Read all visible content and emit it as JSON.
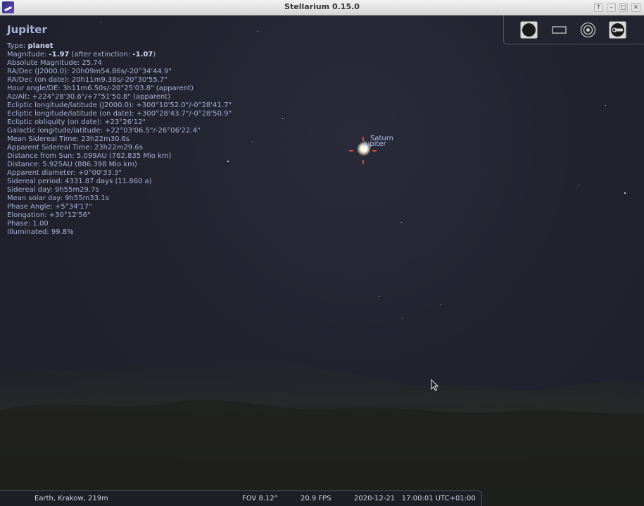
{
  "window": {
    "title": "Stellarium 0.15.0",
    "buttons": [
      "↑",
      "–",
      "□",
      "✕"
    ]
  },
  "object": {
    "name": "Jupiter",
    "info": [
      [
        "Type: ",
        "planet",
        ""
      ],
      [
        "Magnitude: ",
        "-1.97",
        " (after extinction: ",
        "-1.07",
        ")"
      ],
      [
        "Absolute Magnitude: 25.74"
      ],
      [
        "RA/Dec (J2000.0): 20h09m54.86s/-20°34'44.9\""
      ],
      [
        "RA/Dec (on date): 20h11m9.38s/-20°30'55.7\""
      ],
      [
        "Hour angle/DE: 3h11m6.50s/-20°25'03.8\" (apparent)"
      ],
      [
        "Az/Alt: +224°28'30.6\"/+7°51'50.8\" (apparent)"
      ],
      [
        "Ecliptic longitude/latitude (J2000.0): +300°10'52.0\"/-0°28'41.7\""
      ],
      [
        "Ecliptic longitude/latitude (on date): +300°28'43.7\"/-0°28'50.9\""
      ],
      [
        "Ecliptic obliquity (on date): +23°26'12\""
      ],
      [
        "Galactic longitude/latitude: +22°03'06.5\"/-26°06'22.4\""
      ],
      [
        "Mean Sidereal Time: 23h22m30.6s"
      ],
      [
        "Apparent Sidereal Time: 23h22m29.6s"
      ],
      [
        "Distance from Sun: 5.099AU (762.835 Mio km)"
      ],
      [
        "Distance: 5.925AU (886.398 Mio km)"
      ],
      [
        "Apparent diameter: +0°00'33.3\""
      ],
      [
        "Sidereal period: 4331.87 days (11.860 a)"
      ],
      [
        "Sidereal day: 9h55m29.7s"
      ],
      [
        "Mean solar day: 9h55m33.1s"
      ],
      [
        "Phase Angle: +5°34'17\""
      ],
      [
        "Elongation: +30°12'56\""
      ],
      [
        "Phase: 1.00"
      ],
      [
        "Illuminated: 99.8%"
      ]
    ]
  },
  "sky_labels": {
    "saturn": "Saturn",
    "jupiter": "Jupiter"
  },
  "toolbar_icons": [
    "circle-icon",
    "rectangle-icon",
    "target-icon",
    "telescope-icon"
  ],
  "status": {
    "location": "Earth, Krakow, 219m",
    "fov": "FOV 8.12°",
    "fps": "20.9 FPS",
    "datetime": "2020-12-21   17:00:01 UTC+01:00"
  },
  "colors": {
    "marker": "#e8483a",
    "info_text": "#a8b0d4"
  }
}
